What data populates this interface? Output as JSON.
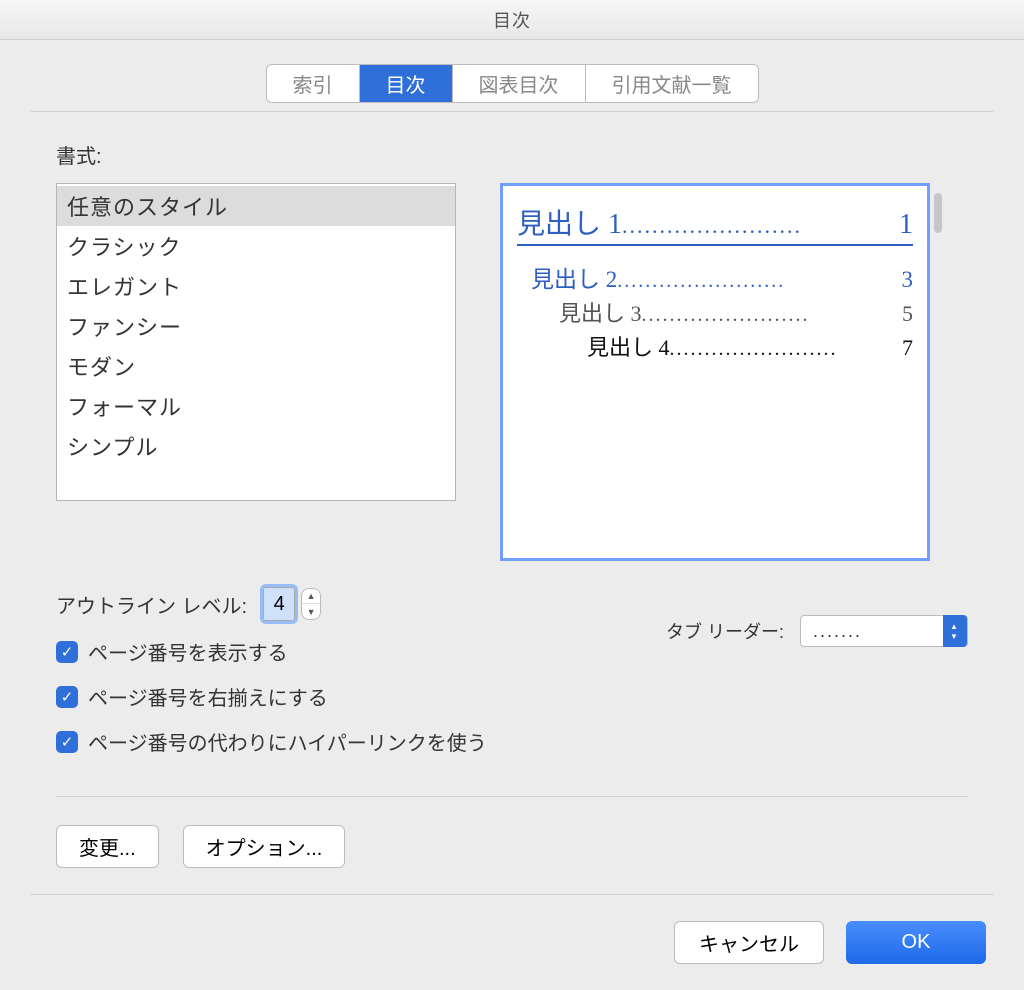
{
  "window": {
    "title": "目次"
  },
  "tabs": [
    {
      "label": "索引",
      "active": false
    },
    {
      "label": "目次",
      "active": true
    },
    {
      "label": "図表目次",
      "active": false
    },
    {
      "label": "引用文献一覧",
      "active": false
    }
  ],
  "format": {
    "label": "書式:",
    "items": [
      "任意のスタイル",
      "クラシック",
      "エレガント",
      "ファンシー",
      "モダン",
      "フォーマル",
      "シンプル"
    ],
    "selected_index": 0
  },
  "preview": {
    "entries": [
      {
        "level": 1,
        "title": "見出し 1",
        "page": "1"
      },
      {
        "level": 2,
        "title": "見出し 2",
        "page": "3"
      },
      {
        "level": 3,
        "title": "見出し 3",
        "page": "5"
      },
      {
        "level": 4,
        "title": "見出し 4",
        "page": "7"
      }
    ],
    "dots": "........................"
  },
  "outline": {
    "label": "アウトライン レベル:",
    "value": "4"
  },
  "options": {
    "show_pages": {
      "label": "ページ番号を表示する",
      "checked": true
    },
    "right_align": {
      "label": "ページ番号を右揃えにする",
      "checked": true
    },
    "hyperlink": {
      "label": "ページ番号の代わりにハイパーリンクを使う",
      "checked": true
    }
  },
  "tab_leader": {
    "label": "タブ リーダー:",
    "value": "......."
  },
  "buttons": {
    "modify": "変更...",
    "options": "オプション...",
    "cancel": "キャンセル",
    "ok": "OK"
  }
}
